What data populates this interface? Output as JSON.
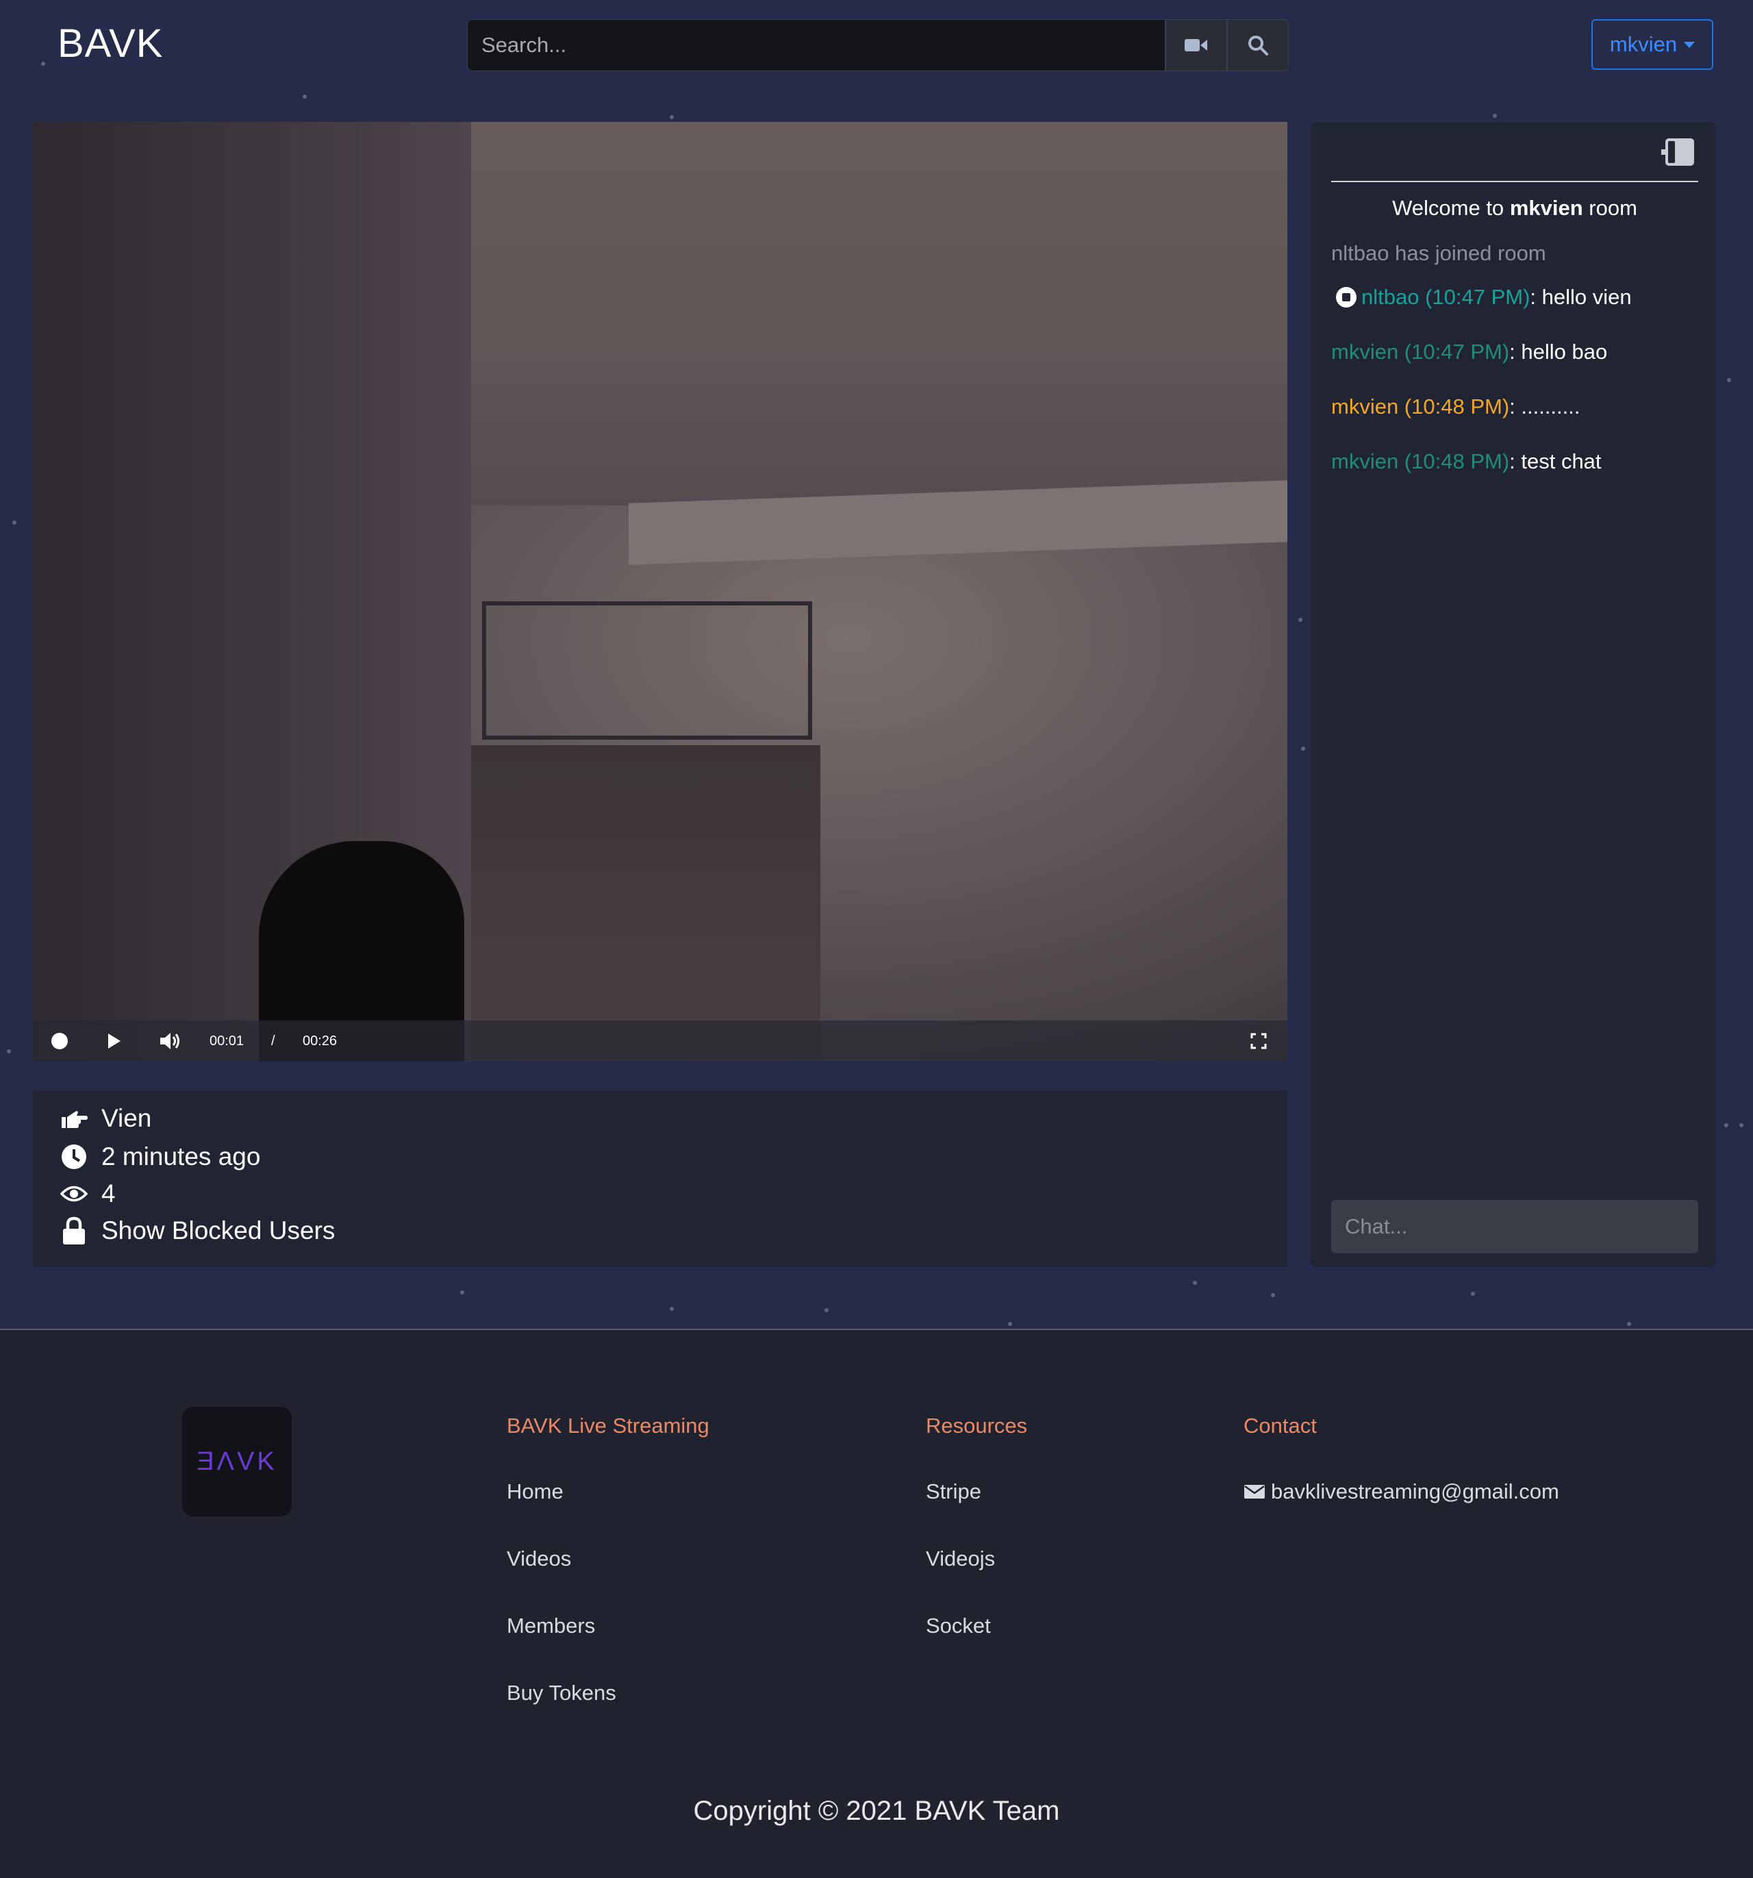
{
  "header": {
    "brand": "BAVK",
    "search_placeholder": "Search...",
    "user_menu_label": "mkvien"
  },
  "player": {
    "current_time": "00:01",
    "separator": "/",
    "duration": "00:26"
  },
  "stream_info": {
    "streamer": "Vien",
    "started": "2 minutes ago",
    "viewers": "4",
    "blocked_users_label": "Show Blocked Users"
  },
  "chat": {
    "welcome_prefix": "Welcome to",
    "welcome_room": "mkvien",
    "welcome_suffix": "room",
    "join_user": "nltbao",
    "join_text": "has joined room",
    "messages": [
      {
        "user": "nltbao (10:47 PM)",
        "text": ": hello vien",
        "color": "#16a39b"
      },
      {
        "user": "mkvien (10:47 PM)",
        "text": ": hello bao",
        "color": "#1f8f74"
      },
      {
        "user": "mkvien (10:48 PM)",
        "text": ": ..........",
        "color": "#f5a623"
      },
      {
        "user": "mkvien (10:48 PM)",
        "text": ": test chat",
        "color": "#1f8f74"
      }
    ],
    "input_placeholder": "Chat..."
  },
  "footer": {
    "logo_text": "ƎΛVK",
    "col1": {
      "title": "BAVK Live Streaming",
      "links": [
        "Home",
        "Videos",
        "Members",
        "Buy Tokens"
      ]
    },
    "col2": {
      "title": "Resources",
      "links": [
        "Stripe",
        "Videojs",
        "Socket"
      ]
    },
    "col3": {
      "title": "Contact",
      "email": "bavklivestreaming@gmail.com"
    },
    "copyright": "Copyright © 2021 BAVK Team"
  },
  "colors": {
    "background": "#262b4a",
    "panel": "#212433",
    "accent_blue": "#1d73e8",
    "footer_heading": "#e98966"
  },
  "icons": [
    "video-camera-icon",
    "search-icon",
    "record-icon",
    "play-icon",
    "volume-icon",
    "fullscreen-icon",
    "pointing-hand-icon",
    "clock-icon",
    "eye-icon",
    "lock-icon",
    "sidebar-toggle-icon",
    "user-dot-icon",
    "envelope-icon"
  ]
}
